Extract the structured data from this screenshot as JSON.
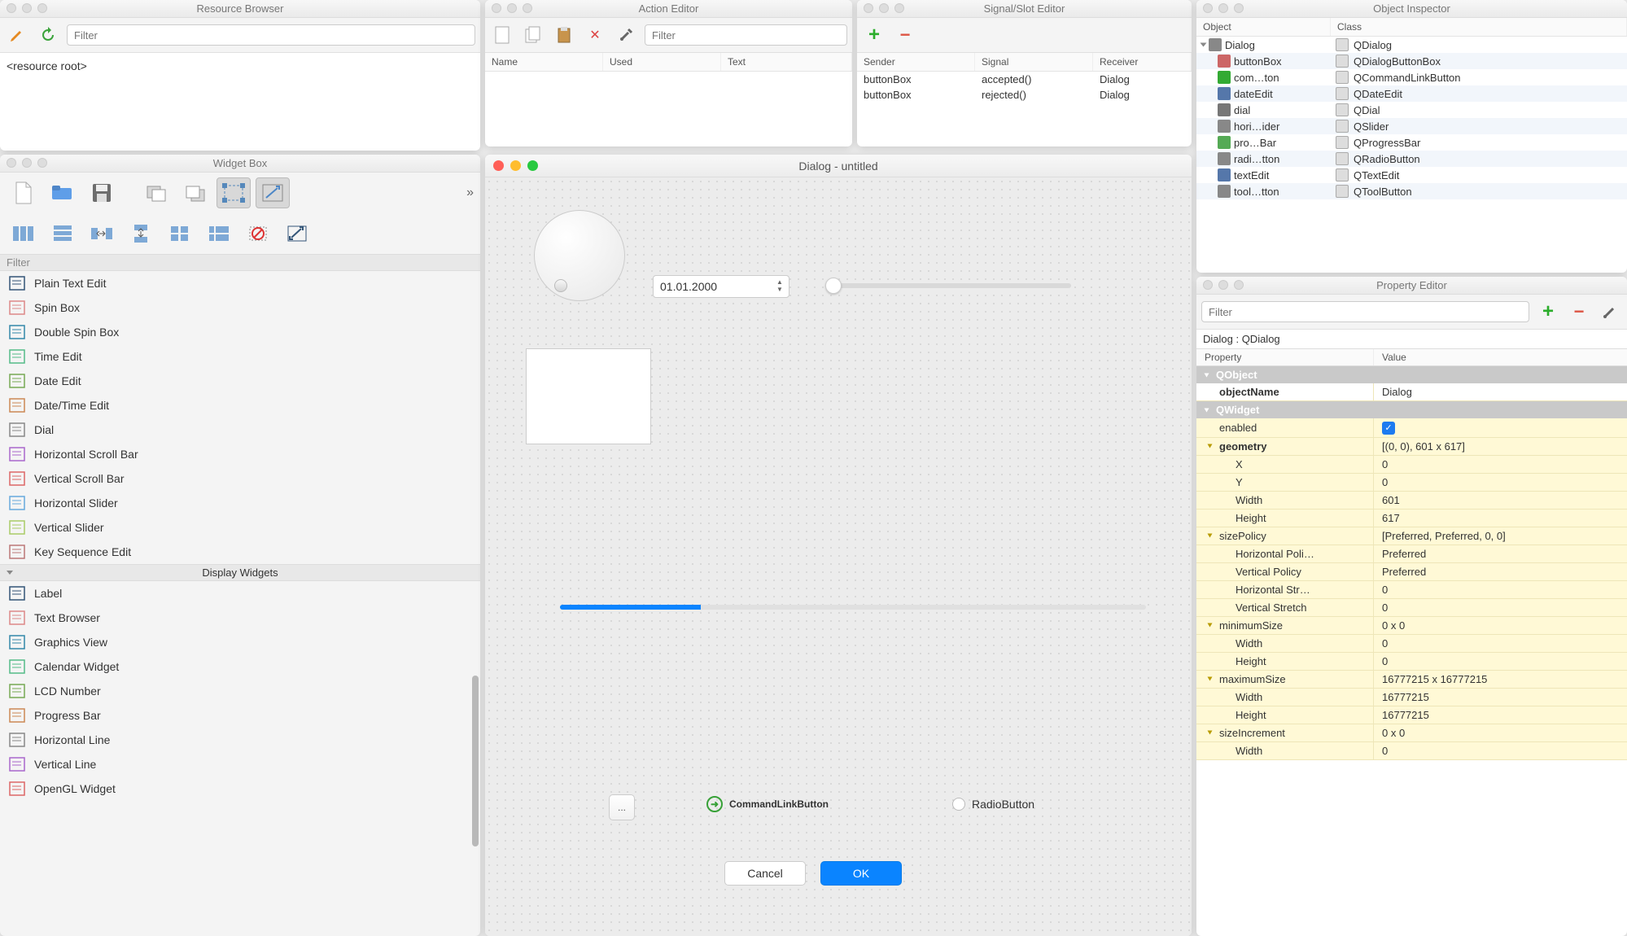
{
  "resource_browser": {
    "title": "Resource Browser",
    "filter_placeholder": "Filter",
    "root_label": "<resource root>"
  },
  "widget_box": {
    "title": "Widget Box",
    "filter_label": "Filter",
    "input_widgets": [
      "Plain Text Edit",
      "Spin Box",
      "Double Spin Box",
      "Time Edit",
      "Date Edit",
      "Date/Time Edit",
      "Dial",
      "Horizontal Scroll Bar",
      "Vertical Scroll Bar",
      "Horizontal Slider",
      "Vertical Slider",
      "Key Sequence Edit"
    ],
    "display_section_title": "Display Widgets",
    "display_widgets": [
      "Label",
      "Text Browser",
      "Graphics View",
      "Calendar Widget",
      "LCD Number",
      "Progress Bar",
      "Horizontal Line",
      "Vertical Line",
      "OpenGL Widget"
    ]
  },
  "action_editor": {
    "title": "Action Editor",
    "filter_placeholder": "Filter",
    "columns": [
      "Name",
      "Used",
      "Text"
    ]
  },
  "signal_slot": {
    "title": "Signal/Slot Editor",
    "columns": [
      "Sender",
      "Signal",
      "Receiver"
    ],
    "rows": [
      {
        "sender": "buttonBox",
        "signal": "accepted()",
        "receiver": "Dialog"
      },
      {
        "sender": "buttonBox",
        "signal": "rejected()",
        "receiver": "Dialog"
      }
    ]
  },
  "object_inspector": {
    "title": "Object Inspector",
    "columns": [
      "Object",
      "Class"
    ],
    "rows": [
      {
        "obj": "Dialog",
        "cls": "QDialog",
        "indent": 0,
        "expand": true
      },
      {
        "obj": "buttonBox",
        "cls": "QDialogButtonBox",
        "indent": 1
      },
      {
        "obj": "com…ton",
        "cls": "QCommandLinkButton",
        "indent": 1
      },
      {
        "obj": "dateEdit",
        "cls": "QDateEdit",
        "indent": 1
      },
      {
        "obj": "dial",
        "cls": "QDial",
        "indent": 1
      },
      {
        "obj": "hori…ider",
        "cls": "QSlider",
        "indent": 1
      },
      {
        "obj": "pro…Bar",
        "cls": "QProgressBar",
        "indent": 1
      },
      {
        "obj": "radi…tton",
        "cls": "QRadioButton",
        "indent": 1
      },
      {
        "obj": "textEdit",
        "cls": "QTextEdit",
        "indent": 1
      },
      {
        "obj": "tool…tton",
        "cls": "QToolButton",
        "indent": 1
      }
    ]
  },
  "canvas": {
    "title": "Dialog - untitled",
    "date_value": "01.01.2000",
    "tool_button_label": "...",
    "command_link_label": "CommandLinkButton",
    "radio_label": "RadioButton",
    "cancel_label": "Cancel",
    "ok_label": "OK"
  },
  "property_editor": {
    "title": "Property Editor",
    "filter_placeholder": "Filter",
    "obj_label": "Dialog : QDialog",
    "columns": [
      "Property",
      "Value"
    ],
    "groups": {
      "qobject": "QObject",
      "qwidget": "QWidget"
    },
    "rows": [
      {
        "k": "objectName",
        "v": "Dialog",
        "bold": true
      },
      {
        "k": "enabled",
        "v": "check"
      },
      {
        "k": "geometry",
        "v": "[(0, 0), 601 x 617]",
        "bold": true,
        "exp": true
      },
      {
        "k": "X",
        "v": "0",
        "lvl": 2
      },
      {
        "k": "Y",
        "v": "0",
        "lvl": 2
      },
      {
        "k": "Width",
        "v": "601",
        "lvl": 2
      },
      {
        "k": "Height",
        "v": "617",
        "lvl": 2
      },
      {
        "k": "sizePolicy",
        "v": "[Preferred, Preferred, 0, 0]",
        "exp": true
      },
      {
        "k": "Horizontal Poli…",
        "v": "Preferred",
        "lvl": 2
      },
      {
        "k": "Vertical Policy",
        "v": "Preferred",
        "lvl": 2
      },
      {
        "k": "Horizontal Str…",
        "v": "0",
        "lvl": 2
      },
      {
        "k": "Vertical Stretch",
        "v": "0",
        "lvl": 2
      },
      {
        "k": "minimumSize",
        "v": "0 x 0",
        "exp": true
      },
      {
        "k": "Width",
        "v": "0",
        "lvl": 2
      },
      {
        "k": "Height",
        "v": "0",
        "lvl": 2
      },
      {
        "k": "maximumSize",
        "v": "16777215 x 16777215",
        "exp": true
      },
      {
        "k": "Width",
        "v": "16777215",
        "lvl": 2
      },
      {
        "k": "Height",
        "v": "16777215",
        "lvl": 2
      },
      {
        "k": "sizeIncrement",
        "v": "0 x 0",
        "exp": true
      },
      {
        "k": "Width",
        "v": "0",
        "lvl": 2
      }
    ]
  }
}
